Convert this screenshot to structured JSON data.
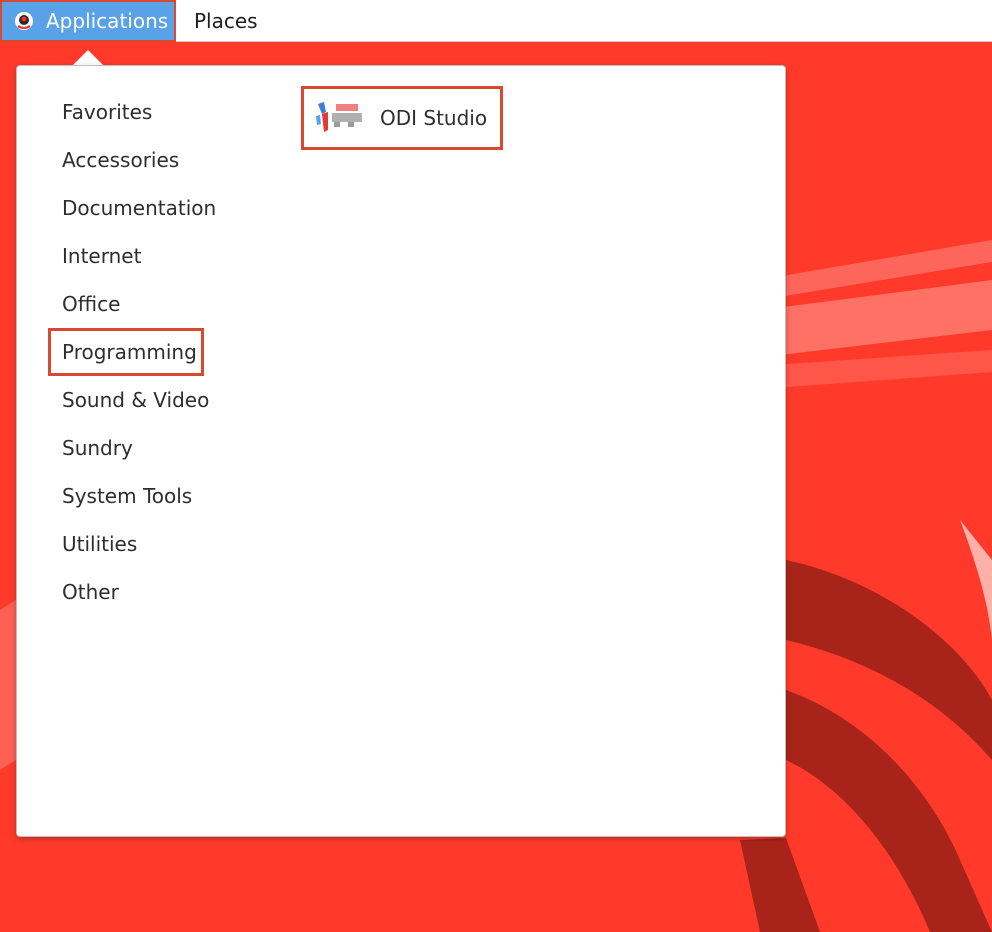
{
  "desktop": {
    "background_color": "#ff3a2a",
    "accent_dark": "#a8241b"
  },
  "topbar": {
    "applications_label": "Applications",
    "applications_icon": "distro-logo-icon",
    "places_label": "Places"
  },
  "menu": {
    "categories": [
      {
        "label": "Favorites"
      },
      {
        "label": "Accessories"
      },
      {
        "label": "Documentation"
      },
      {
        "label": "Internet"
      },
      {
        "label": "Office"
      },
      {
        "label": "Programming",
        "highlighted": true
      },
      {
        "label": "Sound & Video"
      },
      {
        "label": "Sundry"
      },
      {
        "label": "System Tools"
      },
      {
        "label": "Utilities"
      },
      {
        "label": "Other"
      }
    ],
    "apps": [
      {
        "label": "ODI Studio",
        "icon": "odi-studio-icon",
        "highlighted": true
      }
    ]
  },
  "colors": {
    "highlight_border": "#d84930",
    "topbar_active": "#5aa2e8"
  }
}
